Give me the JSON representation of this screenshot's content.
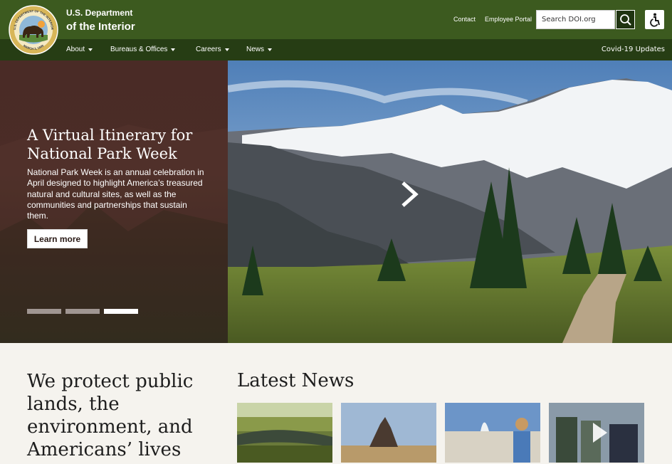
{
  "header": {
    "title_line1": "U.S. Department",
    "title_line2": "of the Interior",
    "seal": {
      "icon": "doi-seal-icon",
      "top_text": "U.S. DEPARTMENT OF THE INTERIOR",
      "bottom_text": "MARCH 3, 1849"
    },
    "utility_links": [
      "Contact",
      "Employee Portal"
    ],
    "search": {
      "placeholder": "Search DOI.org"
    },
    "search_icon": "search-icon",
    "accessibility_icon": "accessibility-icon"
  },
  "nav": {
    "items": [
      "About",
      "Bureaus & Offices",
      "Careers",
      "News"
    ],
    "right_link": "Covid-19 Updates"
  },
  "hero": {
    "title": "A Virtual Itinerary for National Park Week",
    "description": "National Park Week is an annual celebration in April designed to highlight America’s treasured natural and cultural sites, as well as the communities and partnerships that sustain them.",
    "button_label": "Learn more",
    "slides_total": 3,
    "active_slide": 3,
    "next_icon": "chevron-right-icon"
  },
  "mission": {
    "text": "We protect public lands, the environment, and Americans’ lives"
  },
  "news": {
    "heading": "Latest News",
    "thumbnails": [
      "wetland-photo",
      "desert-rock-photo",
      "geyser-hiker-photo",
      "video-people-photo"
    ]
  },
  "colors": {
    "header_green": "#3c5a1f",
    "nav_dark_green": "#263d14",
    "hero_panel": "#4a2b26",
    "page_bg": "#f5f3ee"
  }
}
